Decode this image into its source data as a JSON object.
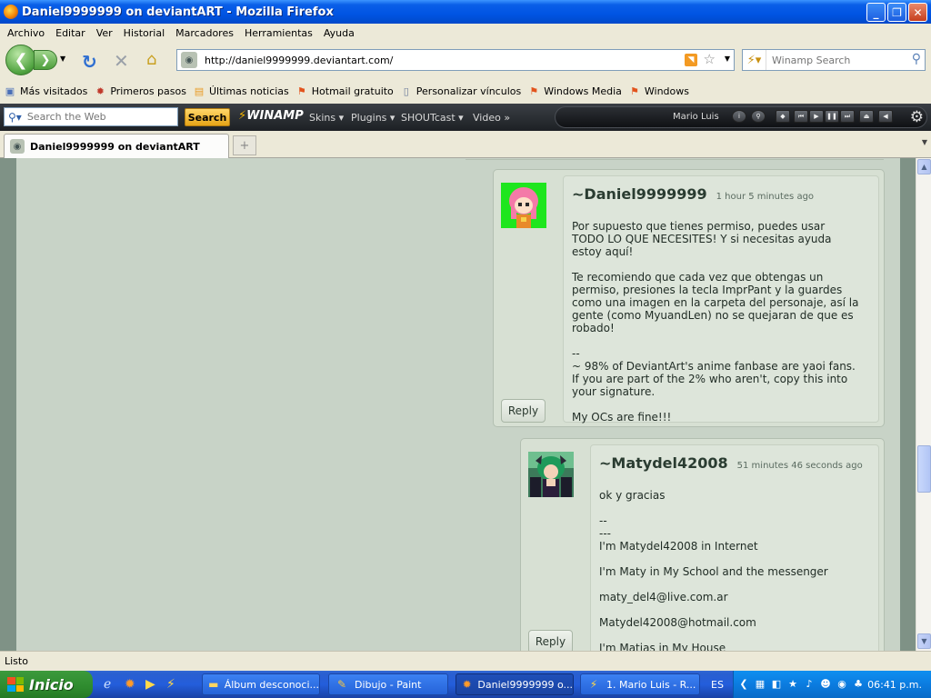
{
  "window": {
    "title": "Daniel9999999 on deviantART - Mozilla Firefox",
    "minimize": "_",
    "maximize": "❐",
    "close": "✕"
  },
  "menu": [
    "Archivo",
    "Editar",
    "Ver",
    "Historial",
    "Marcadores",
    "Herramientas",
    "Ayuda"
  ],
  "navbar": {
    "url": "http://daniel9999999.deviantart.com/",
    "search_placeholder": "Winamp Search"
  },
  "bookmarks": [
    {
      "label": "Más visitados",
      "icon": "bookmarks-folder-icon"
    },
    {
      "label": "Primeros pasos",
      "icon": "firefox-icon"
    },
    {
      "label": "Últimas noticias",
      "icon": "rss-icon"
    },
    {
      "label": "Hotmail gratuito",
      "icon": "windows-flag-icon"
    },
    {
      "label": "Personalizar vínculos",
      "icon": "page-icon"
    },
    {
      "label": "Windows Media",
      "icon": "windows-flag-icon"
    },
    {
      "label": "Windows",
      "icon": "windows-flag-icon"
    }
  ],
  "winamp": {
    "search_placeholder": "Search the Web",
    "search_button": "Search",
    "logo": "WINAMP",
    "menus": [
      "Skins",
      "Plugins",
      "SHOUTcast",
      "Video"
    ],
    "user": "Mario Luis"
  },
  "tab": {
    "label": "Daniel9999999 on deviantART"
  },
  "comments": [
    {
      "username": "~Daniel9999999",
      "timestamp": "1 hour 5 minutes ago",
      "text": "Por supuesto que tienes permiso, puedes usar\nTODO LO QUE NECESITES! Y si necesitas ayuda\nestoy aquí!\n\nTe recomiendo que cada vez que obtengas un\npermiso, presiones la tecla ImprPant y la guardes\ncomo una imagen en la carpeta del personaje, así la\ngente (como MyuandLen) no se quejaran de que es\nrobado!\n\n--\n~ 98% of DeviantArt's anime fanbase are yaoi fans.\nIf you are part of the 2% who aren't, copy this into\nyour signature.\n\nMy OCs are fine!!!",
      "reply": "Reply"
    },
    {
      "username": "~Matydel42008",
      "timestamp": "51 minutes 46 seconds ago",
      "text": "ok y gracias\n\n--\n---\nI'm Matydel42008 in Internet\n\nI'm Maty in My School and the messenger\n\nmaty_del4@live.com.ar\n\nMatydel42008@hotmail.com\n\nI'm Matias in My House",
      "reply": "Reply"
    }
  ],
  "status": "Listo",
  "taskbar": {
    "start": "Inicio",
    "tasks": [
      {
        "label": "Álbum desconoci...",
        "icon": "folder-icon"
      },
      {
        "label": "Dibujo - Paint",
        "icon": "paint-icon"
      },
      {
        "label": "Daniel9999999 o...",
        "icon": "firefox-icon",
        "active": true
      },
      {
        "label": "1. Mario Luis - R...",
        "icon": "winamp-icon"
      }
    ],
    "language": "ES",
    "clock": "06:41 p.m."
  }
}
